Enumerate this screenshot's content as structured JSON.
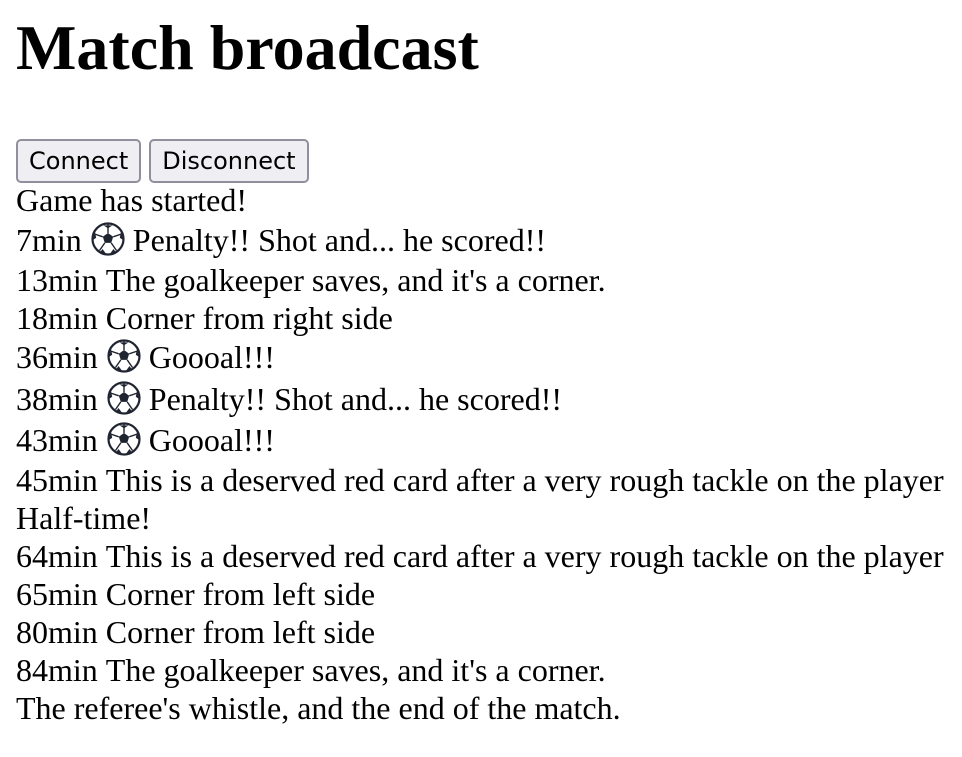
{
  "page": {
    "title": "Match broadcast"
  },
  "controls": {
    "connect_label": "Connect",
    "disconnect_label": "Disconnect"
  },
  "events": [
    {
      "minute": "",
      "text": "Game has started!",
      "icon": ""
    },
    {
      "minute": "7min",
      "text": "Penalty!! Shot and... he scored!!",
      "icon": "soccer-ball-icon"
    },
    {
      "minute": "13min",
      "text": "The goalkeeper saves, and it's a corner.",
      "icon": ""
    },
    {
      "minute": "18min",
      "text": "Corner from right side",
      "icon": ""
    },
    {
      "minute": "36min",
      "text": "Goooal!!!",
      "icon": "soccer-ball-icon"
    },
    {
      "minute": "38min",
      "text": "Penalty!! Shot and... he scored!!",
      "icon": "soccer-ball-icon"
    },
    {
      "minute": "43min",
      "text": "Goooal!!!",
      "icon": "soccer-ball-icon"
    },
    {
      "minute": "45min",
      "text": "This is a deserved red card after a very rough tackle on the player",
      "icon": ""
    },
    {
      "minute": "",
      "text": "Half-time!",
      "icon": ""
    },
    {
      "minute": "64min",
      "text": "This is a deserved red card after a very rough tackle on the player",
      "icon": ""
    },
    {
      "minute": "65min",
      "text": "Corner from left side",
      "icon": ""
    },
    {
      "minute": "80min",
      "text": "Corner from left side",
      "icon": ""
    },
    {
      "minute": "84min",
      "text": "The goalkeeper saves, and it's a corner.",
      "icon": ""
    },
    {
      "minute": "",
      "text": "The referee's whistle, and the end of the match.",
      "icon": ""
    }
  ],
  "colors": {
    "button_background": "#efeff3",
    "button_border": "#8f8f9d",
    "text": "#000000"
  }
}
